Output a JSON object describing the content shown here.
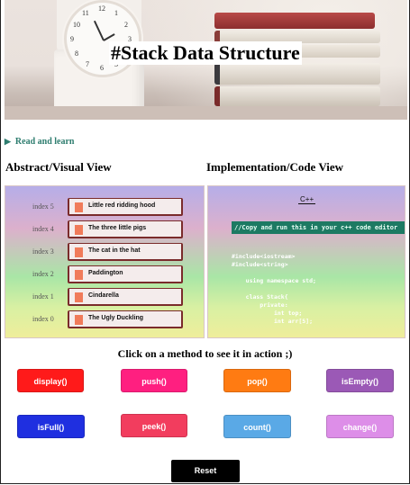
{
  "hero": {
    "title": "#Stack Data Structure",
    "clock_numbers": [
      "12",
      "1",
      "2",
      "3",
      "4",
      "5",
      "6",
      "7",
      "8",
      "9",
      "10",
      "11"
    ]
  },
  "read_learn": {
    "label": "Read and learn"
  },
  "views": {
    "abstract_heading": "Abstract/Visual View",
    "implementation_heading": "Implementation/Code View"
  },
  "stack": {
    "items": [
      {
        "index": "index 5",
        "title": "Little red ridding hood"
      },
      {
        "index": "index 4",
        "title": "The three little pigs"
      },
      {
        "index": "index 3",
        "title": "The cat in the hat"
      },
      {
        "index": "index 2",
        "title": "Paddington"
      },
      {
        "index": "index 1",
        "title": "Cindarella"
      },
      {
        "index": "index 0",
        "title": "The Ugly Duckling"
      }
    ]
  },
  "code": {
    "language": "C++",
    "comment": "//Copy and run this in your c++ code editor",
    "lines": "#include<iostream>\n#include<string>\n\n    using namespace std;\n\n    class Stack{\n        private:\n            int top;\n            int arr[5];"
  },
  "prompt": "Click on a method to see it in action ;)",
  "methods": {
    "display": {
      "label": "display()",
      "color": "#ff1a1a"
    },
    "push": {
      "label": "push()",
      "color": "#ff1f80"
    },
    "pop": {
      "label": "pop()",
      "color": "#ff7b12"
    },
    "isEmpty": {
      "label": "isEmpty()",
      "color": "#9b59b6"
    },
    "isFull": {
      "label": "isFull()",
      "color": "#1f2fe0"
    },
    "peek": {
      "label": "peek()",
      "color": "#f23d5e"
    },
    "count": {
      "label": "count()",
      "color": "#5aa9e6"
    },
    "change": {
      "label": "change()",
      "color": "#dd8ee8"
    }
  },
  "reset": {
    "label": "Reset"
  }
}
